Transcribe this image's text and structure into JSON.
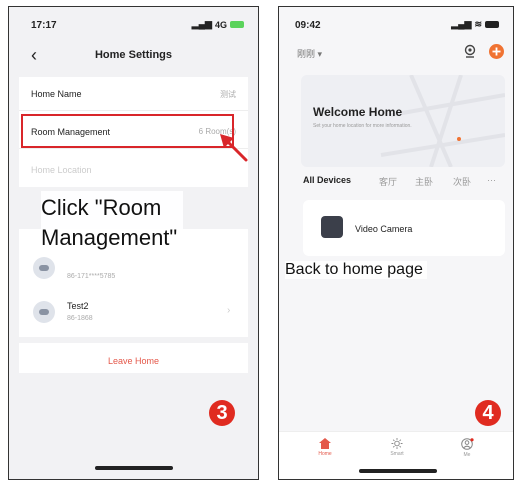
{
  "left_screen": {
    "status_time": "17:17",
    "network": "4G",
    "header": {
      "back_icon": "chevron-left-icon",
      "title": "Home Settings"
    },
    "rows": [
      {
        "label": "Home Name",
        "value": "测试"
      },
      {
        "label": "Room Management",
        "value": "6 Room(s)"
      }
    ],
    "location_label": "Home Location",
    "annotation": {
      "line1": "Click \"Room",
      "line2": "Management\""
    },
    "members": [
      {
        "name": "",
        "phone": "86-171****5785"
      },
      {
        "name": "Test2",
        "phone": "86-1868"
      }
    ],
    "leave_button": "Leave Home",
    "step_number": "3"
  },
  "right_screen": {
    "status_time": "09:42",
    "location_label": "刚刚",
    "welcome": {
      "title": "Welcome Home",
      "subtitle": "Set your home location for more information."
    },
    "tabs": [
      "All Devices",
      "客厅",
      "主卧",
      "次卧",
      "···"
    ],
    "device": {
      "name": "Video Camera"
    },
    "annotation": "Back to home page",
    "tabbar": [
      {
        "label": "Home",
        "icon": "house-icon"
      },
      {
        "label": "Smart",
        "icon": "sun-icon"
      },
      {
        "label": "Me",
        "icon": "profile-icon"
      }
    ],
    "step_number": "4"
  },
  "colors": {
    "highlight": "#d9262a",
    "accent": "#e4584a",
    "badge": "#e02b20"
  }
}
